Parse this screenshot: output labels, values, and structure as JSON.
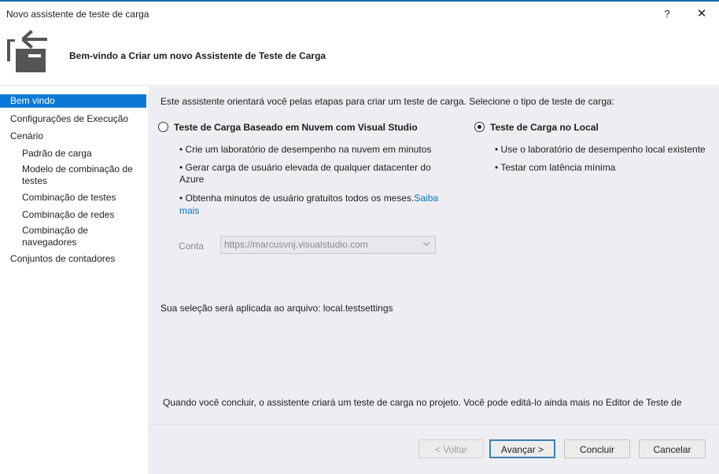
{
  "window": {
    "title": "Novo assistente de teste de carga",
    "help_label": "?",
    "close_label": "✕"
  },
  "header": {
    "title": "Bem-vindo a Criar um novo Assistente de Teste de Carga",
    "icon": "load-test-wizard-icon"
  },
  "sidebar": {
    "items": [
      {
        "label": "Bem vindo",
        "selected": true
      },
      {
        "label": "Configurações de Execução"
      },
      {
        "label": "Cenário"
      },
      {
        "label": "Padrão de carga"
      },
      {
        "label": "Modelo de combinação de",
        "label2": "testes"
      },
      {
        "label": "Combinação de testes"
      },
      {
        "label": "Combinação de redes"
      },
      {
        "label": "Combinação de",
        "label2": "navegadores"
      },
      {
        "label": "Conjuntos de contadores"
      }
    ]
  },
  "main": {
    "intro": "Este assistente orientará você pelas etapas para criar um teste de carga. Selecione o tipo de teste de carga:",
    "cloud_option": {
      "label": "Teste de Carga Baseado em Nuvem com Visual Studio",
      "selected": false,
      "bullets": [
        "• Crie um laboratório de desempenho na nuvem em minutos",
        "• Gerar carga de usuário elevada de qualquer datacenter do",
        "Azure",
        "• Obtenha minutos de usuário gratuitos todos os meses.",
        "mais"
      ],
      "link_text": "Saiba",
      "account_label": "Conta",
      "account_value": "https://marcusvnj.visualstudio.com"
    },
    "local_option": {
      "label": "Teste de Carga no Local",
      "selected": true,
      "bullets": [
        "• Use o laboratório de desempenho local existente",
        "• Testar com latência mínima"
      ]
    },
    "selection_note": "Sua seleção será aplicada ao arquivo: local.testsettings",
    "finish_note": "Quando você concluir, o assistente criará um teste de carga no projeto. Você pode editá-lo ainda mais no Editor de Teste de"
  },
  "buttons": {
    "back": "< Voltar",
    "next": "Avançar >",
    "finish": "Concluir",
    "cancel": "Cancelar"
  },
  "colors": {
    "accent": "#0a78d7",
    "panel": "#eeeef2",
    "link": "#0e70c0"
  }
}
